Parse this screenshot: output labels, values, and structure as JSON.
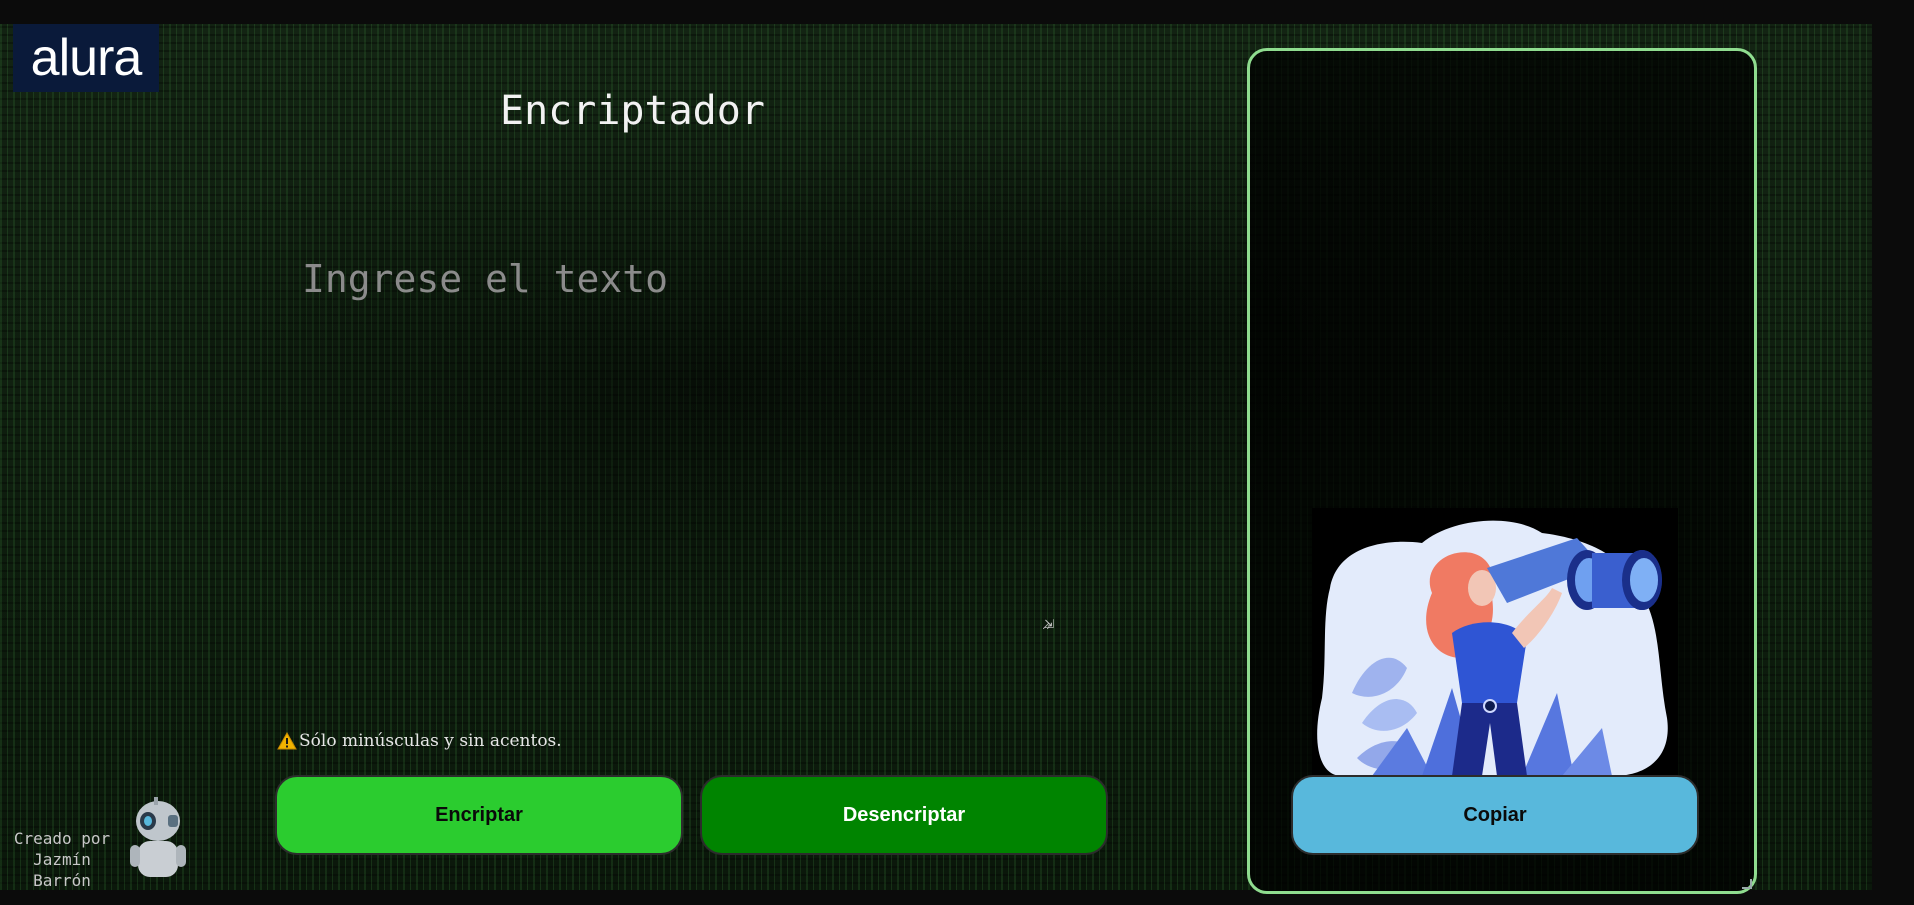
{
  "header": {
    "logo_text": "alura",
    "title": "Encriptador"
  },
  "input": {
    "placeholder": "Ingrese el texto"
  },
  "hint": {
    "text": "Sólo minúsculas y sin acentos.",
    "icon": "warning-icon"
  },
  "buttons": {
    "encrypt_label": "Encriptar",
    "decrypt_label": "Desencriptar",
    "copy_label": "Copiar"
  },
  "footer": {
    "credit_line1": "Creado por",
    "credit_line2": "Jazmín",
    "credit_line3": "Barrón"
  },
  "colors": {
    "encrypt_button": "#2bcc2f",
    "decrypt_button": "#008400",
    "copy_button": "#58b8dc",
    "panel_border": "#8fdc8f",
    "logo_bg": "#0a1a3a"
  },
  "icons": {
    "illustration": "woman-with-binoculars",
    "robot": "robot-mascot"
  }
}
